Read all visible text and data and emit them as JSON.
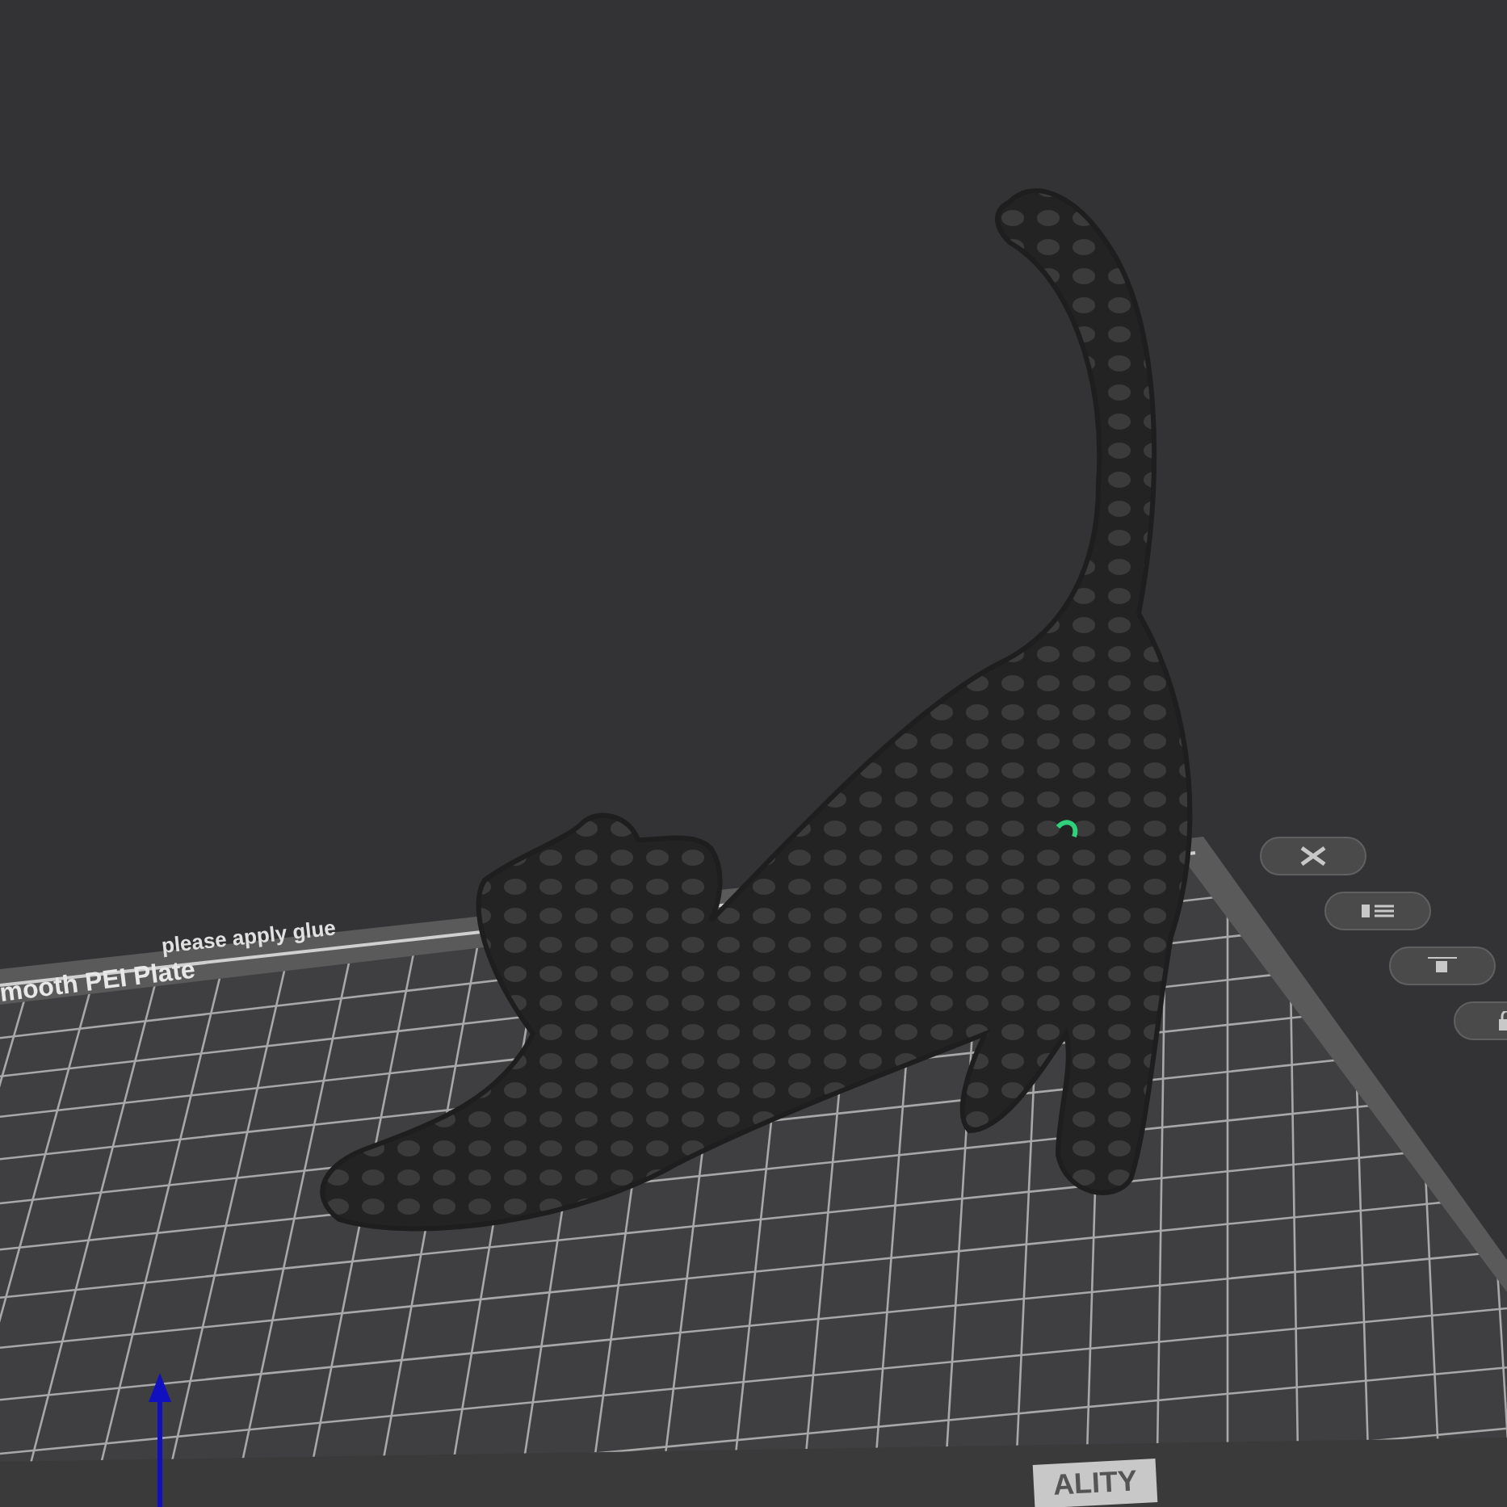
{
  "viewport": {
    "plate_labels": [
      "please apply glue",
      "mooth PEI Plate"
    ],
    "brand_label": "ALITY"
  },
  "tool_buttons": [
    {
      "kind": "close"
    },
    {
      "kind": "list"
    },
    {
      "kind": "arrange"
    },
    {
      "kind": "lock"
    }
  ]
}
